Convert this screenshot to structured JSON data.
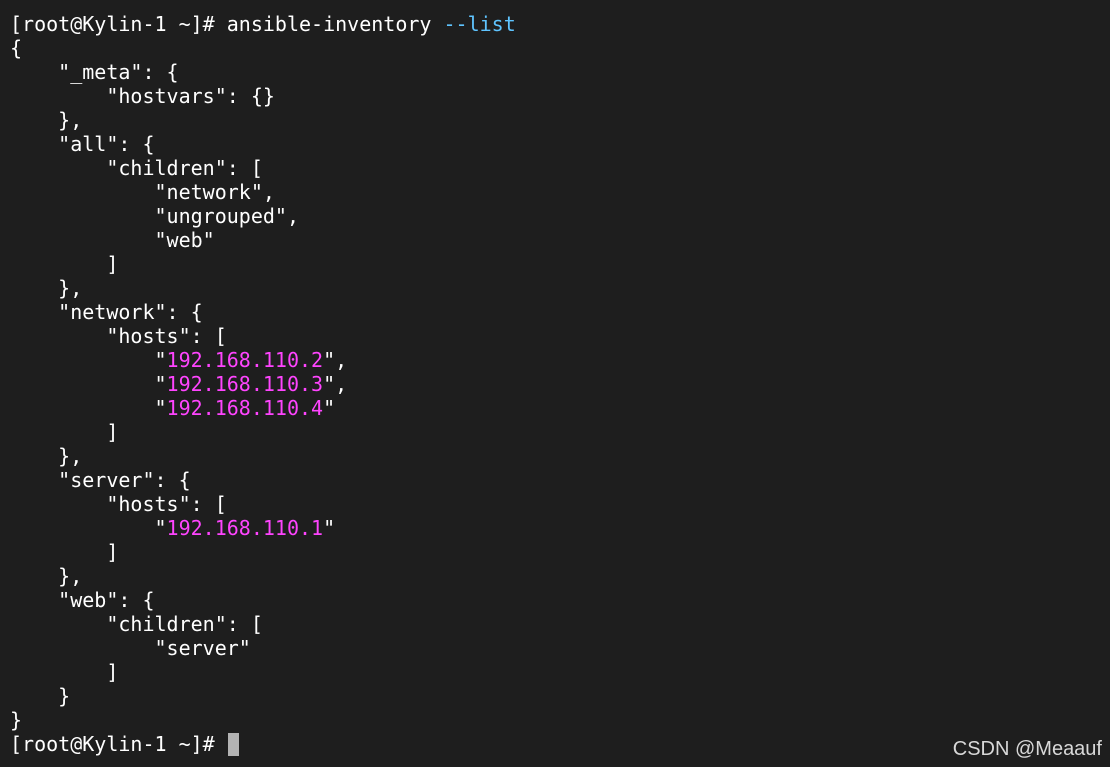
{
  "terminal": {
    "prompt": "[root@Kylin-1 ~]# ",
    "command": "ansible-inventory ",
    "command_flag": "--list",
    "output": {
      "l01": "{",
      "l02": "    \"_meta\": {",
      "l03": "        \"hostvars\": {}",
      "l04": "    },",
      "l05": "    \"all\": {",
      "l06": "        \"children\": [",
      "l07": "            \"network\",",
      "l08": "            \"ungrouped\",",
      "l09": "            \"web\"",
      "l10": "        ]",
      "l11": "    },",
      "l12": "    \"network\": {",
      "l13": "        \"hosts\": [",
      "l14": {
        "pre": "            \"",
        "ip": "192.168.110.2",
        "post": "\","
      },
      "l15": {
        "pre": "            \"",
        "ip": "192.168.110.3",
        "post": "\","
      },
      "l16": {
        "pre": "            \"",
        "ip": "192.168.110.4",
        "post": "\""
      },
      "l17": "        ]",
      "l18": "    },",
      "l19": "    \"server\": {",
      "l20": "        \"hosts\": [",
      "l21": {
        "pre": "            \"",
        "ip": "192.168.110.1",
        "post": "\""
      },
      "l22": "        ]",
      "l23": "    },",
      "l24": "    \"web\": {",
      "l25": "        \"children\": [",
      "l26": "            \"server\"",
      "l27": "        ]",
      "l28": "    }",
      "l29": "}"
    },
    "final_prompt": "[root@Kylin-1 ~]# "
  },
  "watermark": "CSDN @Meaauf",
  "colors": {
    "background": "#1e1e1e",
    "text": "#ffffff",
    "ip_highlight": "#ff44ff",
    "flag_highlight": "#5fc4ff",
    "cursor": "#b3b3b3"
  }
}
